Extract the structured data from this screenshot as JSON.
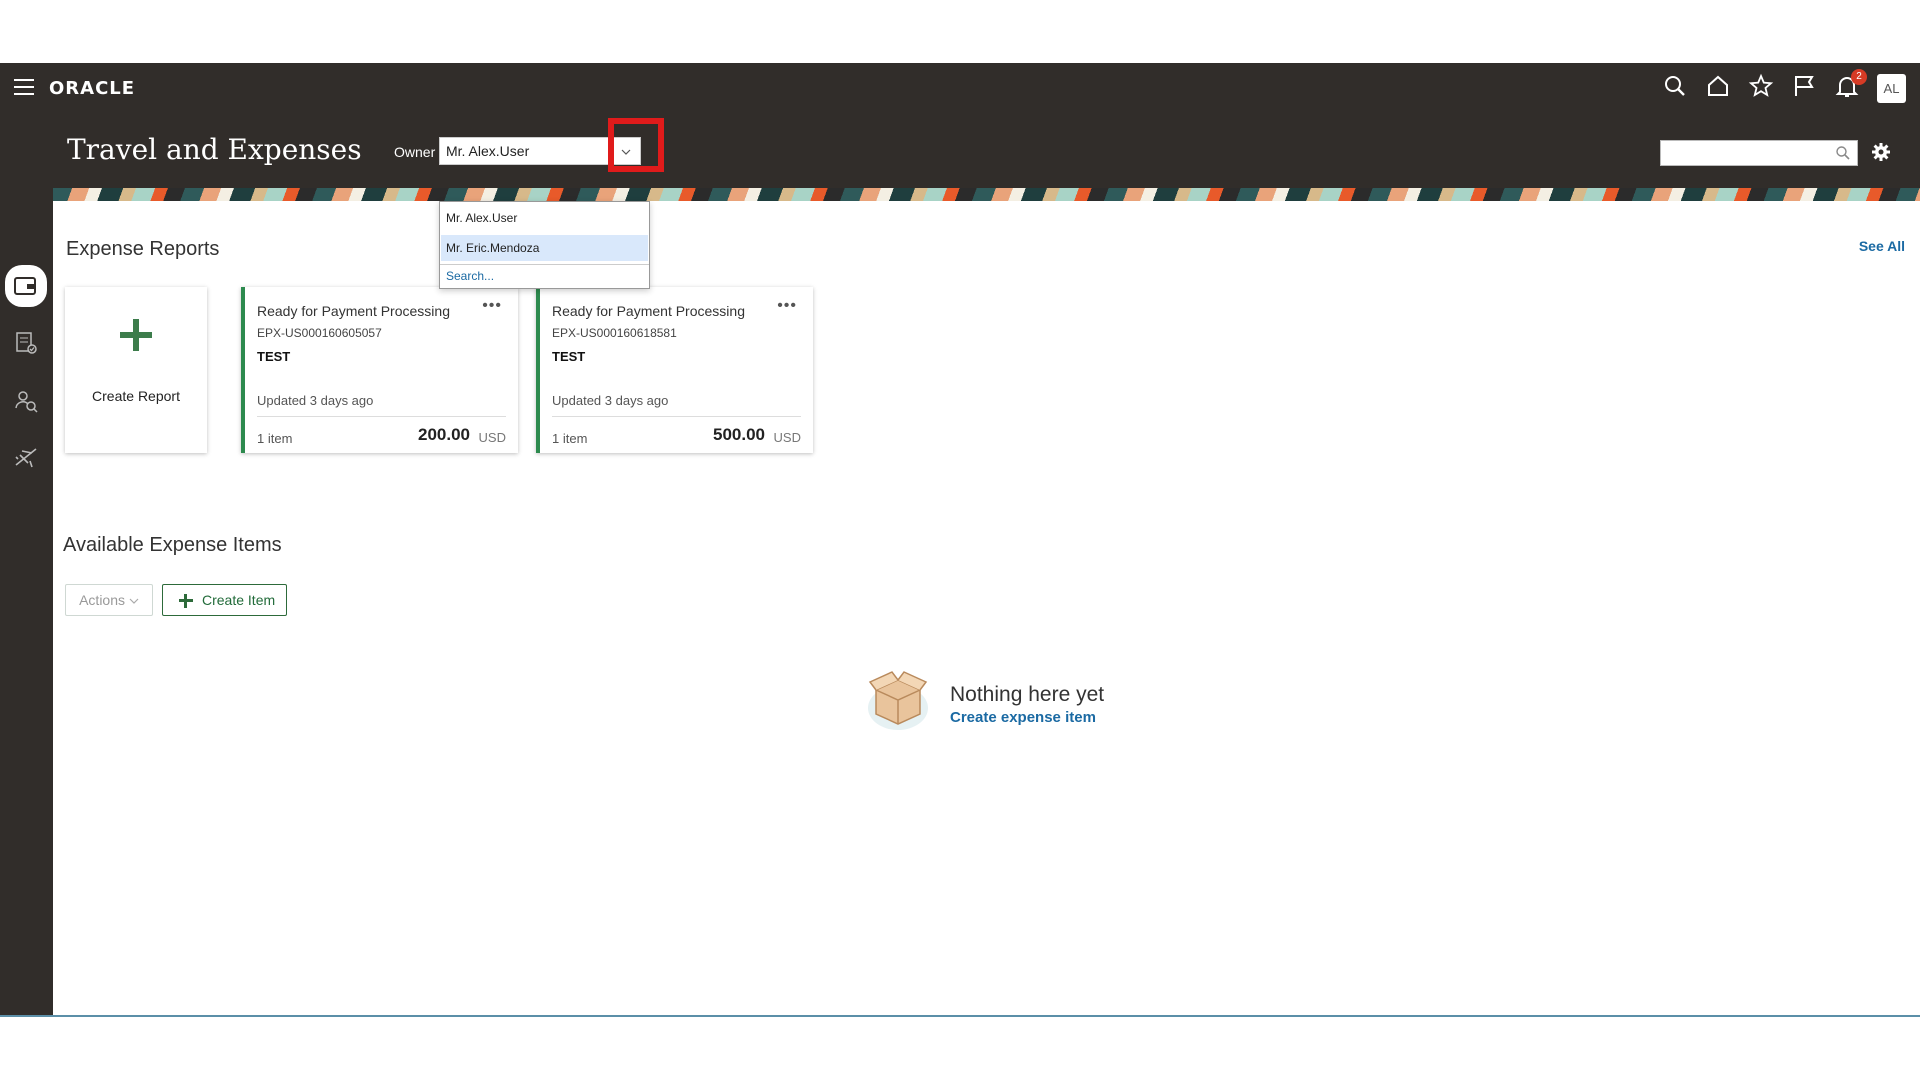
{
  "topbar": {
    "logo": "ORACLE",
    "notification_count": "2",
    "avatar_initials": "AL"
  },
  "header": {
    "title": "Travel and Expenses",
    "owner_label": "Owner",
    "owner_value": "Mr. Alex.User"
  },
  "owner_dropdown": {
    "options": [
      "Mr. Alex.User",
      "Mr. Eric.Mendoza"
    ],
    "highlighted": "Mr. Eric.Mendoza",
    "search_label": "Search..."
  },
  "expense_reports": {
    "title": "Expense Reports",
    "see_all": "See All",
    "create_label": "Create Report",
    "cards": [
      {
        "status": "Ready for Payment Processing",
        "id": "EPX-US000160605057",
        "purpose": "TEST",
        "updated": "Updated 3 days ago",
        "items": "1 item",
        "amount": "200.00",
        "currency": "USD"
      },
      {
        "status": "Ready for Payment Processing",
        "id": "EPX-US000160618581",
        "purpose": "TEST",
        "updated": "Updated 3 days ago",
        "items": "1 item",
        "amount": "500.00",
        "currency": "USD"
      }
    ]
  },
  "expense_items": {
    "title": "Available Expense Items",
    "actions_label": "Actions",
    "create_label": "Create Item",
    "empty_title": "Nothing here yet",
    "empty_link": "Create expense item"
  },
  "colors": {
    "header_bg": "#312d2a",
    "accent_green": "#2d8a4e",
    "link_blue": "#1b6aa3",
    "highlight_red": "#e01b1b",
    "badge_red": "#d63b25"
  },
  "icons": {
    "rail": [
      "wallet-icon",
      "report-approve-icon",
      "people-search-icon",
      "travel-plane-icon"
    ],
    "topbar": [
      "search-icon",
      "home-icon",
      "star-icon",
      "flag-icon",
      "bell-icon"
    ]
  }
}
